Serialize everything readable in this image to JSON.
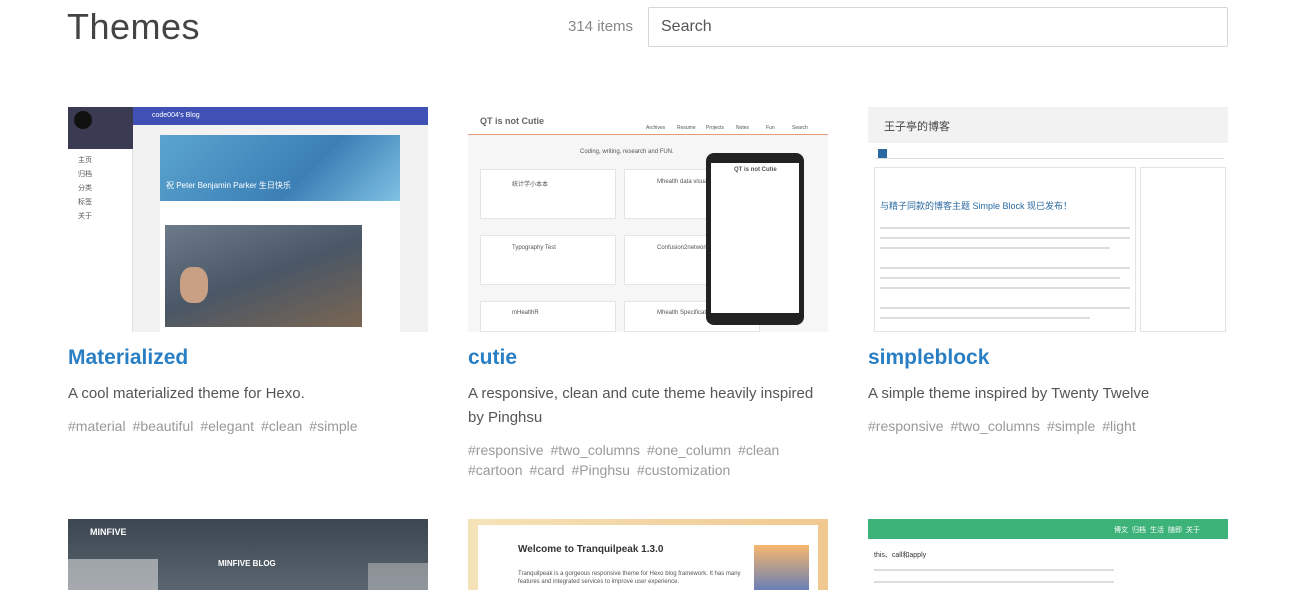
{
  "header": {
    "title": "Themes",
    "count": "314 items",
    "search_placeholder": "Search"
  },
  "cards": [
    {
      "name": "Materialized",
      "description": "A cool materialized theme for Hexo.",
      "tags": [
        "#material",
        "#beautiful",
        "#elegant",
        "#clean",
        "#simple"
      ],
      "thumb": {
        "blog_title": "code004's Blog",
        "post_title": "祝 Peter Benjamin Parker 生日快乐",
        "menu": [
          "主页",
          "归档",
          "分类",
          "标签",
          "关于"
        ]
      }
    },
    {
      "name": "cutie",
      "description": "A responsive, clean and cute theme heavily inspired by Pinghsu",
      "tags": [
        "#responsive",
        "#two_columns",
        "#one_column",
        "#clean",
        "#cartoon",
        "#card",
        "#Pinghsu",
        "#customization"
      ],
      "thumb": {
        "site_title": "QT is not Cutie",
        "nav": [
          "Archives",
          "Resume",
          "Projects",
          "Notes",
          "Fun",
          "Search"
        ],
        "subtitle": "Coding, writing, research and FUN.",
        "posts": [
          "统计学小本本",
          "Mhealth data visualizer",
          "Typography Test",
          "Confusion2network",
          "mHealthR",
          "Mhealth Specification"
        ]
      }
    },
    {
      "name": "simpleblock",
      "description": "A simple theme inspired by Twenty Twelve",
      "tags": [
        "#responsive",
        "#two_columns",
        "#simple",
        "#light"
      ],
      "thumb": {
        "site_title": "王子亭的博客",
        "post_title": "与精子同款的博客主题 Simple Block 现已发布！"
      }
    },
    {
      "thumb": {
        "site_title": "MINFIVE",
        "hero": "MINFIVE BLOG"
      }
    },
    {
      "thumb": {
        "post_title": "Welcome to Tranquilpeak 1.3.0",
        "excerpt": "Tranquilpeak is a gorgeous responsive theme for Hexo blog framework. It has many features and integrated services to improve user experience."
      }
    },
    {
      "thumb": {
        "post_title": "this、call和apply",
        "nav": [
          "博文",
          "归档",
          "生活",
          "随即",
          "关于"
        ]
      }
    }
  ]
}
